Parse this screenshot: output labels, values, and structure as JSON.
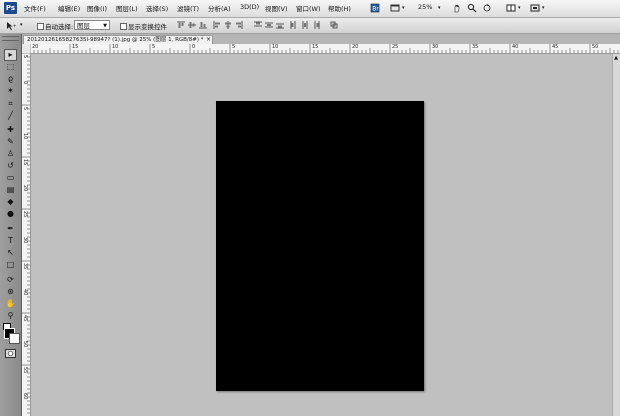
{
  "app": {
    "logo_text": "Ps"
  },
  "menu": [
    "文件(F)",
    "编辑(E)",
    "图像(I)",
    "图层(L)",
    "选择(S)",
    "滤镜(T)",
    "分析(A)",
    "3D(D)",
    "视图(V)",
    "窗口(W)",
    "帮助(H)"
  ],
  "menubar": {
    "zoom_value": "25%"
  },
  "options": {
    "auto_select_label": "自动选择:",
    "layer_select_value": "图层",
    "show_transform_label": "显示变换控件"
  },
  "document": {
    "tab_title": "20120126165827635l-98947? (1).jpg @ 25% (图层 1, RGB/8#) *",
    "close_symbol": "×"
  },
  "ruler_top": [
    "20",
    "15",
    "10",
    "5",
    "0",
    "5",
    "10",
    "15",
    "20",
    "25",
    "30",
    "35",
    "40",
    "45",
    "50"
  ],
  "ruler_left": [
    "5",
    "0",
    "5",
    "10",
    "15",
    "20",
    "25",
    "30",
    "35",
    "40",
    "45",
    "50",
    "55",
    "60"
  ],
  "colors": {
    "foreground": "#000000",
    "background": "#ffffff",
    "canvas_fill": "#000000",
    "workspace": "#c0c0c0"
  },
  "tools": [
    {
      "name": "move-tool",
      "glyph": "▸"
    },
    {
      "name": "marquee-tool",
      "glyph": "⬚"
    },
    {
      "name": "lasso-tool",
      "glyph": "ϱ"
    },
    {
      "name": "magic-wand-tool",
      "glyph": "✶"
    },
    {
      "name": "crop-tool",
      "glyph": "⌗"
    },
    {
      "name": "eyedropper-tool",
      "glyph": "╱"
    },
    {
      "name": "healing-brush-tool",
      "glyph": "✚"
    },
    {
      "name": "brush-tool",
      "glyph": "✎"
    },
    {
      "name": "clone-stamp-tool",
      "glyph": "♙"
    },
    {
      "name": "history-brush-tool",
      "glyph": "↺"
    },
    {
      "name": "eraser-tool",
      "glyph": "▭"
    },
    {
      "name": "gradient-tool",
      "glyph": "▤"
    },
    {
      "name": "blur-tool",
      "glyph": "◆"
    },
    {
      "name": "dodge-tool",
      "glyph": "●"
    },
    {
      "name": "pen-tool",
      "glyph": "✒"
    },
    {
      "name": "type-tool",
      "glyph": "T"
    },
    {
      "name": "path-selection-tool",
      "glyph": "↖"
    },
    {
      "name": "shape-tool",
      "glyph": "□"
    },
    {
      "name": "3d-rotate-tool",
      "glyph": "⟳"
    },
    {
      "name": "3d-orbit-tool",
      "glyph": "⊛"
    },
    {
      "name": "hand-tool",
      "glyph": "✋"
    },
    {
      "name": "zoom-tool",
      "glyph": "⚲"
    }
  ]
}
